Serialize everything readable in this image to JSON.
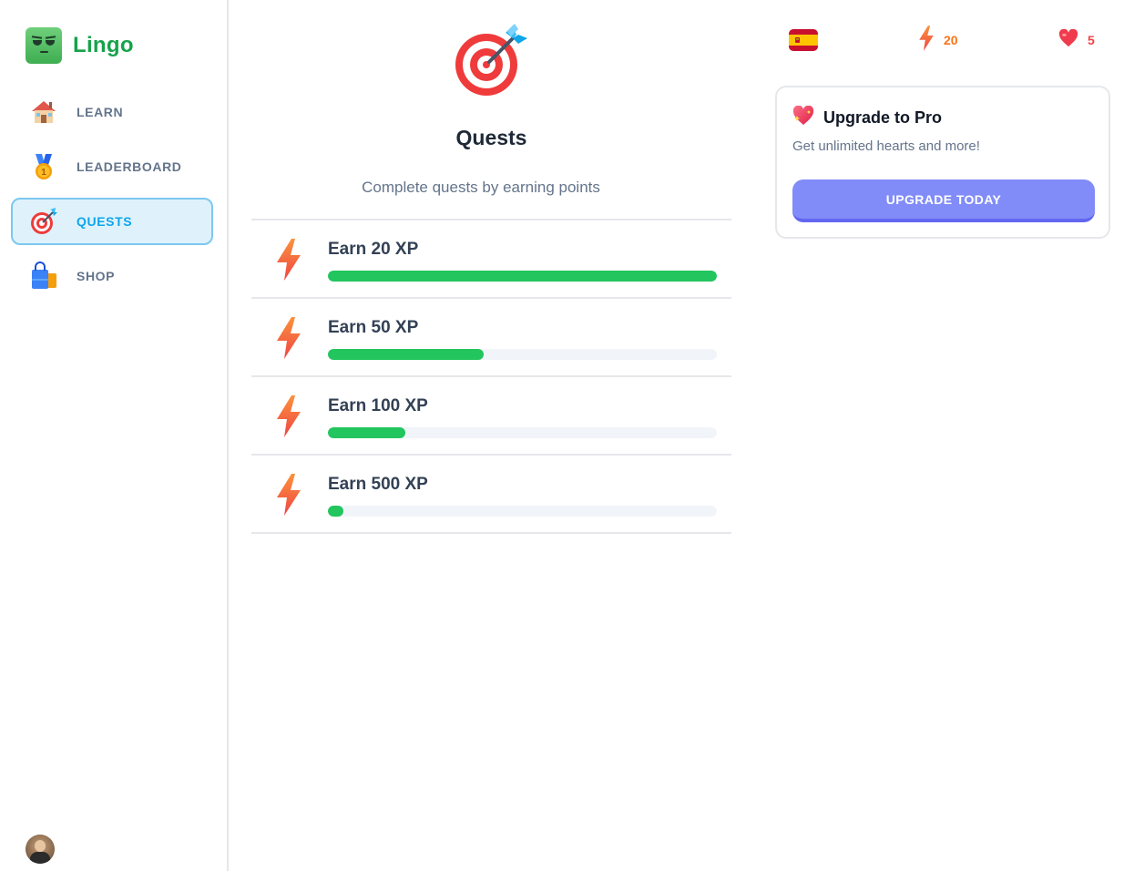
{
  "app": {
    "name": "Lingo"
  },
  "sidebar": {
    "items": [
      {
        "label": "LEARN",
        "icon": "house-icon",
        "active": false
      },
      {
        "label": "LEADERBOARD",
        "icon": "medal-icon",
        "active": false
      },
      {
        "label": "QUESTS",
        "icon": "target-icon",
        "active": true
      },
      {
        "label": "SHOP",
        "icon": "shopping-bag-icon",
        "active": false
      }
    ],
    "avatar_icon": "user-avatar"
  },
  "main": {
    "icon": "target-dart-icon",
    "title": "Quests",
    "subtitle": "Complete quests by earning points",
    "quests": [
      {
        "title": "Earn 20 XP",
        "progress_percent": 100,
        "icon": "lightning-icon"
      },
      {
        "title": "Earn 50 XP",
        "progress_percent": 40,
        "icon": "lightning-icon"
      },
      {
        "title": "Earn 100 XP",
        "progress_percent": 20,
        "icon": "lightning-icon"
      },
      {
        "title": "Earn 500 XP",
        "progress_percent": 4,
        "icon": "lightning-icon"
      }
    ]
  },
  "stats": {
    "course_flag": "spain-flag-icon",
    "xp": "20",
    "hearts": "5"
  },
  "promo": {
    "title": "Upgrade to Pro",
    "text": "Get unlimited hearts and more!",
    "button_label": "UPGRADE TODAY"
  },
  "colors": {
    "brand": "#16a34a",
    "active_nav_bg": "#dff2fc",
    "active_nav_text": "#0ea5e9",
    "progress": "#22c55e",
    "xp": "#f97316",
    "hearts": "#ef4444",
    "button": "#818cf8"
  }
}
